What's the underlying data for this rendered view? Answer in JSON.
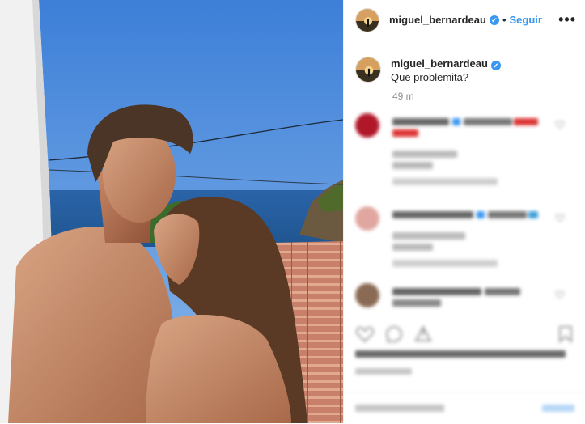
{
  "post": {
    "username": "miguel_bernardeau",
    "verified_mark": "✔",
    "separator": "•",
    "follow_label": "Seguir",
    "more_label": "•••",
    "caption_username": "miguel_bernardeau",
    "caption_text": " Que problemita?",
    "time_ago": "49 m"
  },
  "icons": {
    "like": "heart-icon",
    "comment": "comment-icon",
    "share": "share-icon",
    "save": "bookmark-icon",
    "options": "more-icon"
  },
  "colors": {
    "accent": "#3897f0",
    "text": "#262626",
    "muted": "#8e8e8e",
    "border": "#efefef"
  }
}
